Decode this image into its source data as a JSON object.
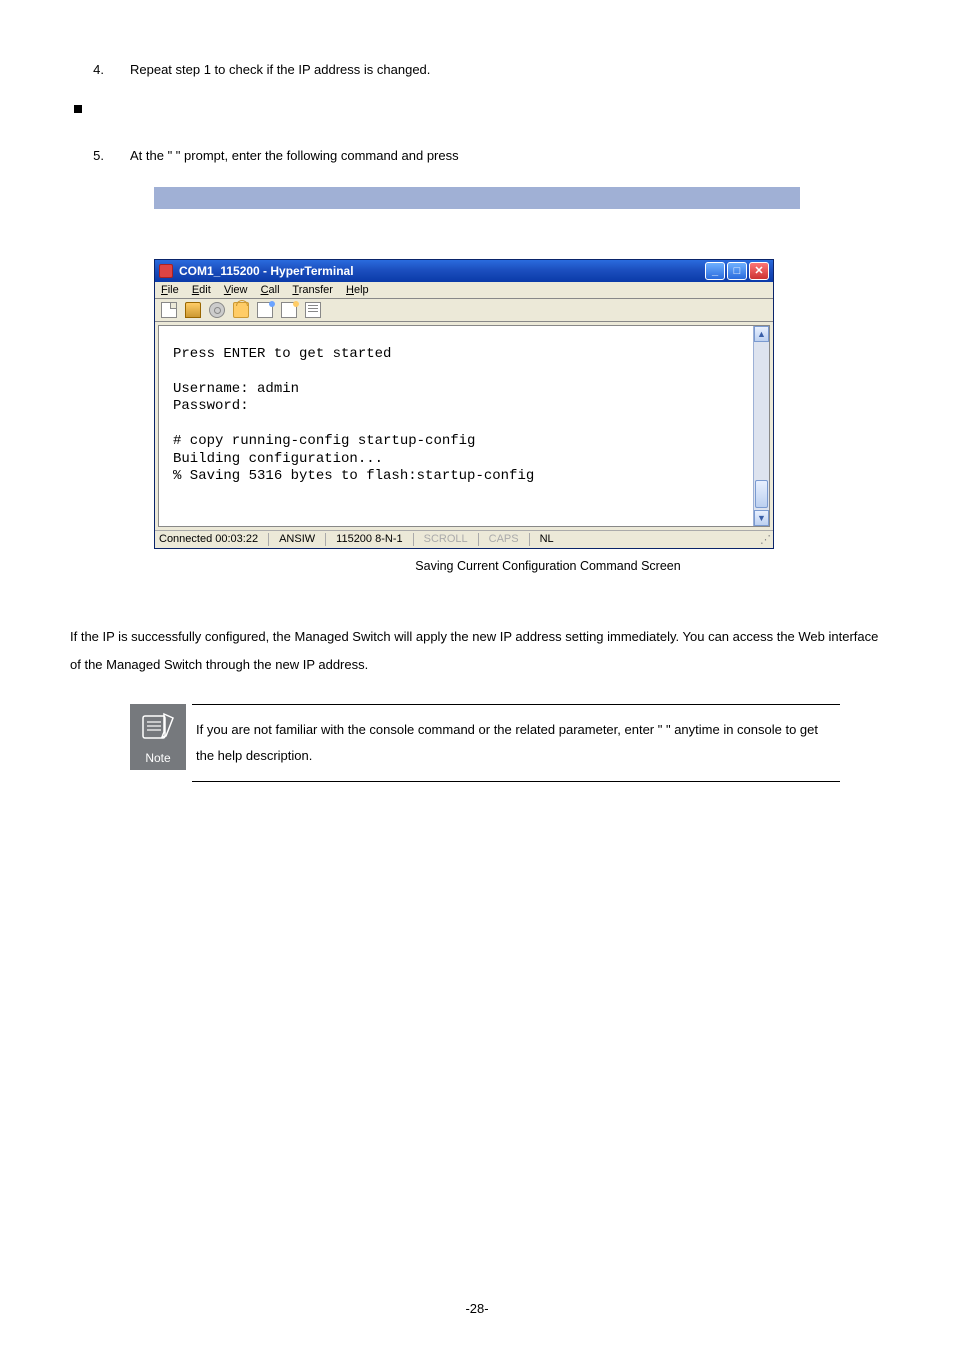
{
  "steps": {
    "s4_num": "4.",
    "s4_txt": "Repeat step 1 to check if the IP address is changed.",
    "s5_num": "5.",
    "s5_txt": "At the \"  \" prompt, enter the following command and press"
  },
  "ht": {
    "title": "COM1_115200 - HyperTerminal",
    "menu": {
      "file": "File",
      "edit": "Edit",
      "view": "View",
      "call": "Call",
      "transfer": "Transfer",
      "help": "Help"
    },
    "term_lines": "Press ENTER to get started\n\nUsername: admin\nPassword:\n\n# copy running-config startup-config\nBuilding configuration...\n% Saving 5316 bytes to flash:startup-config",
    "status": {
      "connected": "Connected 00:03:22",
      "emul": "ANSIW",
      "params": "115200 8-N-1",
      "scroll": "SCROLL",
      "caps": "CAPS",
      "nl": "NL"
    }
  },
  "caption": "Saving Current Configuration Command Screen",
  "para1": "If the IP is successfully configured, the Managed Switch will apply the new IP address setting immediately. You can access the Web interface of the Managed Switch through the new IP address.",
  "note": {
    "label": "Note",
    "text": "If you are not familiar with the console command or the related parameter, enter \"   \" anytime in console to get the help description."
  },
  "page_number": "-28-"
}
